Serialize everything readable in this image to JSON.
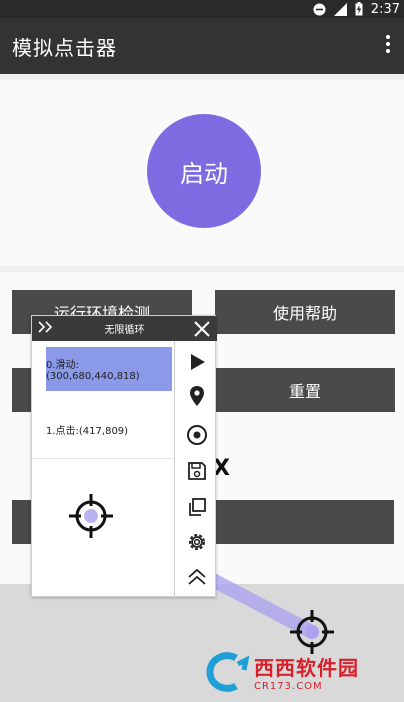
{
  "status_bar": {
    "time": "2:37",
    "icons": [
      "minus-circle-icon",
      "signal-icon",
      "battery-charging-icon"
    ]
  },
  "app_bar": {
    "title": "模拟点击器",
    "menu_icon": "more-vertical-icon"
  },
  "main": {
    "start_label": "启动",
    "buttons": {
      "env_check": "运行环境检测",
      "help": "使用帮助",
      "reset": "重置"
    },
    "partial_text": "X"
  },
  "overlay": {
    "collapse_icon": "double-chevron-right-icon",
    "mode": "无限循环",
    "close_icon": "close-icon",
    "items": [
      {
        "label": "0.滑动:(300,680,440,818)",
        "active": true
      },
      {
        "label": "1.点击:(417,809)",
        "active": false
      }
    ],
    "tools": [
      "play-icon",
      "location-pin-icon",
      "target-icon",
      "save-icon",
      "copy-icon",
      "gear-icon",
      "chevron-up-icon"
    ]
  },
  "watermark": {
    "cn": "西西软件园",
    "en": "CR173.COM"
  },
  "colors": {
    "accent": "#7d6be2",
    "selection": "#8b9ae8",
    "button": "#4a4a4a",
    "appbar": "#333333"
  }
}
